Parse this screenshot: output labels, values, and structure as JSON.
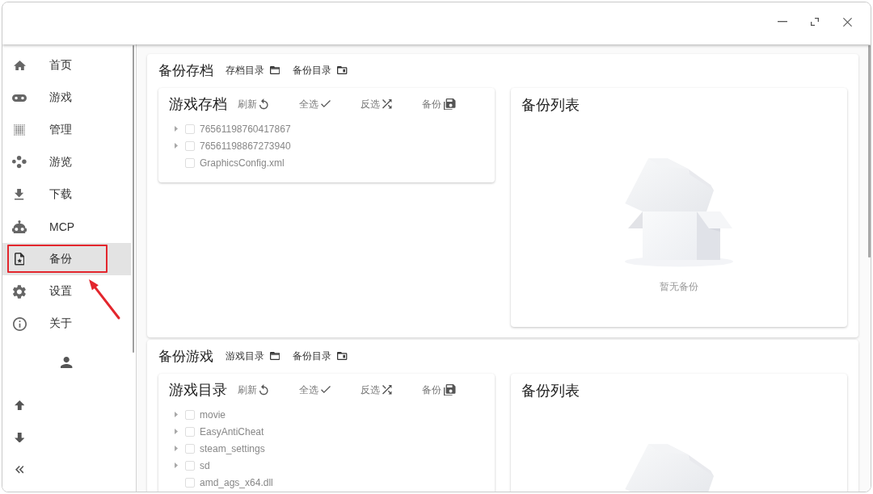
{
  "window": {
    "controls": [
      {
        "kind": "minimize"
      },
      {
        "kind": "maximize"
      },
      {
        "kind": "close"
      }
    ]
  },
  "sidebar": {
    "items": [
      {
        "kind": "home",
        "label": "首页",
        "selected": false,
        "highlighted": false
      },
      {
        "kind": "games",
        "label": "游戏",
        "selected": false,
        "highlighted": false
      },
      {
        "kind": "manage",
        "label": "管理",
        "selected": false,
        "highlighted": false
      },
      {
        "kind": "browse",
        "label": "游览",
        "selected": false,
        "highlighted": false
      },
      {
        "kind": "download",
        "label": "下载",
        "selected": false,
        "highlighted": false
      },
      {
        "kind": "mcp",
        "label": "MCP",
        "selected": false,
        "highlighted": false
      },
      {
        "kind": "backup",
        "label": "备份",
        "selected": true,
        "highlighted": true
      },
      {
        "kind": "settings",
        "label": "设置",
        "selected": false,
        "highlighted": false
      },
      {
        "kind": "about",
        "label": "关于",
        "selected": false,
        "highlighted": false
      }
    ],
    "bottom_buttons": [
      {
        "kind": "up"
      },
      {
        "kind": "down"
      },
      {
        "kind": "collapse"
      }
    ]
  },
  "sections": [
    {
      "title": "备份存档",
      "links": [
        {
          "kind": "source",
          "label": "存档目录"
        },
        {
          "kind": "backup",
          "label": "备份目录"
        }
      ],
      "files_panel": {
        "title": "游戏存档",
        "actions": [
          {
            "kind": "refresh",
            "label": "刷新"
          },
          {
            "kind": "select-all",
            "label": "全选"
          },
          {
            "kind": "invert",
            "label": "反选"
          },
          {
            "kind": "backup",
            "label": "备份"
          }
        ],
        "tree": [
          {
            "kind": "folder",
            "label": "76561198760417867",
            "checked": false
          },
          {
            "kind": "folder",
            "label": "76561198867273940",
            "checked": false
          },
          {
            "kind": "file",
            "label": "GraphicsConfig.xml",
            "checked": false
          }
        ]
      },
      "backup_panel": {
        "title": "备份列表",
        "empty_text": "暂无备份"
      }
    },
    {
      "title": "备份游戏",
      "links": [
        {
          "kind": "source",
          "label": "游戏目录"
        },
        {
          "kind": "backup",
          "label": "备份目录"
        }
      ],
      "files_panel": {
        "title": "游戏目录",
        "actions": [
          {
            "kind": "refresh",
            "label": "刷新"
          },
          {
            "kind": "select-all",
            "label": "全选"
          },
          {
            "kind": "invert",
            "label": "反选"
          },
          {
            "kind": "backup",
            "label": "备份"
          }
        ],
        "tree": [
          {
            "kind": "folder",
            "label": "movie",
            "checked": false
          },
          {
            "kind": "folder",
            "label": "EasyAntiCheat",
            "checked": false
          },
          {
            "kind": "folder",
            "label": "steam_settings",
            "checked": false
          },
          {
            "kind": "folder",
            "label": "sd",
            "checked": false
          },
          {
            "kind": "file",
            "label": "amd_ags_x64.dll",
            "checked": false
          }
        ]
      },
      "backup_panel": {
        "title": "备份列表"
      }
    }
  ]
}
